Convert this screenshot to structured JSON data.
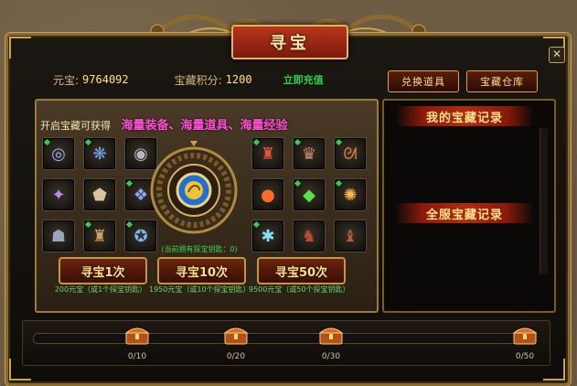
{
  "window": {
    "title": "寻宝",
    "close_symbol": "✕"
  },
  "stats": {
    "ingot_label": "元宝:",
    "ingot_value": "9764092",
    "points_label": "宝藏积分:",
    "points_value": "1200",
    "recharge_label": "立即充值"
  },
  "buttons": {
    "exchange": "兑换道具",
    "warehouse": "宝藏仓库"
  },
  "promo": {
    "small": "开启宝藏可获得",
    "big": "海量装备、海量道具、海量经验"
  },
  "left_items": [
    {
      "icon": "ring-icon",
      "glyph": "◎",
      "color": "#8fb3ff",
      "new": true
    },
    {
      "icon": "butterfly-icon",
      "glyph": "❋",
      "color": "#6aa6ff",
      "new": true
    },
    {
      "icon": "ring-dark-icon",
      "glyph": "◉",
      "color": "#b7b7c7",
      "new": false
    },
    {
      "icon": "crystal-icon",
      "glyph": "✦",
      "color": "#b48cff",
      "new": false
    },
    {
      "icon": "shield-icon",
      "glyph": "⬟",
      "color": "#d9c3a0",
      "new": false
    },
    {
      "icon": "bracer-icon",
      "glyph": "❖",
      "color": "#8aa8ff",
      "new": true
    },
    {
      "icon": "helmet-icon",
      "glyph": "☗",
      "color": "#9aa4c2",
      "new": false
    },
    {
      "icon": "armor-icon",
      "glyph": "♜",
      "color": "#c9a460",
      "new": true
    },
    {
      "icon": "amulet-icon",
      "glyph": "✪",
      "color": "#7db4ff",
      "new": true
    }
  ],
  "right_items": [
    {
      "icon": "armor-red-icon",
      "glyph": "♜",
      "color": "#e0553a",
      "new": true
    },
    {
      "icon": "robe-icon",
      "glyph": "♛",
      "color": "#c98a70",
      "new": true
    },
    {
      "icon": "dragon-icon",
      "glyph": "ᘛ",
      "color": "#c77a3a",
      "new": true
    },
    {
      "icon": "fire-orb-icon",
      "glyph": "●",
      "color": "#ff6a2a",
      "new": false
    },
    {
      "icon": "green-gem-icon",
      "glyph": "◆",
      "color": "#56e04a",
      "new": true
    },
    {
      "icon": "gold-orb-icon",
      "glyph": "✺",
      "color": "#ffb84a",
      "new": true
    },
    {
      "icon": "ice-crystal-icon",
      "glyph": "✱",
      "color": "#7fe3ff",
      "new": true
    },
    {
      "icon": "leggings-icon",
      "glyph": "♞",
      "color": "#c14a32",
      "new": false
    },
    {
      "icon": "boots-icon",
      "glyph": "♝",
      "color": "#b85a40",
      "new": false
    }
  ],
  "key_count": "(当前拥有探宝钥匙：0)",
  "seek_buttons": [
    {
      "label": "寻宝1次",
      "cost": "200元宝（或1个探宝钥匙）"
    },
    {
      "label": "寻宝10次",
      "cost": "1950元宝（或10个探宝钥匙）"
    },
    {
      "label": "寻宝50次",
      "cost": "9500元宝（或50个探宝钥匙）"
    }
  ],
  "records": {
    "mine": "我的宝藏记录",
    "server": "全服宝藏记录"
  },
  "progress": {
    "fill_fraction": 0.0,
    "milestones": [
      "0/10",
      "0/20",
      "0/30",
      "0/50"
    ]
  },
  "colors": {
    "accent_gold": "#c9a552",
    "recharge_green": "#27d34a",
    "promo_pink": "#ff4fd4"
  }
}
